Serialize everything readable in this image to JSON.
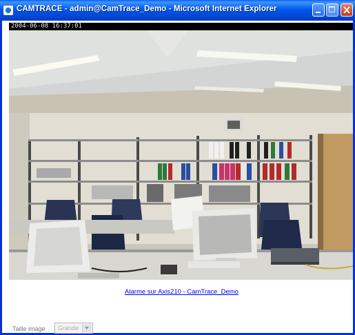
{
  "window": {
    "title": "CAMTRACE - admin@CamTrace_Demo - Microsoft Internet Explorer",
    "buttons": {
      "minimize": "minimize",
      "maximize": "maximize",
      "close": "close"
    }
  },
  "camera": {
    "timestamp": "2004-06-08 16:37:01",
    "image_alt": "Live camera view of an office room"
  },
  "alarm_link": "Alarme sur Axis210 - CamTrace_Demo",
  "image_size": {
    "label": "Taille image",
    "selected": "Grande",
    "enabled": false
  },
  "colors": {
    "titlebar": "#0058ee",
    "link": "#0000ee",
    "window_border": "#0831d9"
  }
}
